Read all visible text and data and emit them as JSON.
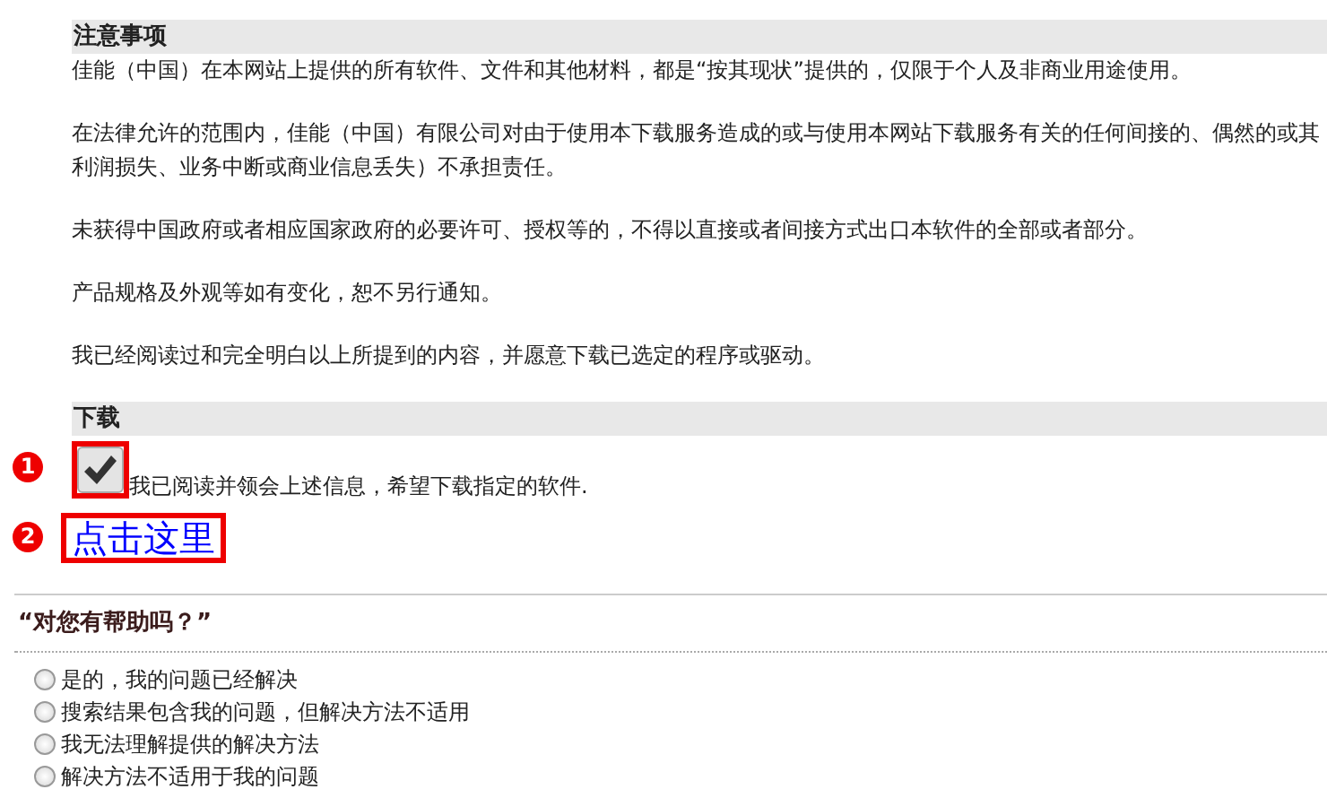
{
  "notice": {
    "heading": "注意事项",
    "paragraphs": [
      {
        "lines": [
          "佳能（中国）在本网站上提供的所有软件、文件和其他材料，都是“按其现状”提供的，仅限于个人及非商业用途使用。"
        ]
      },
      {
        "lines": [
          "在法律允许的范围内，佳能（中国）有限公司对由于使用本下载服务造成的或与使用本网站下载服务有关的任何间接的、偶然的或其",
          "利润损失、业务中断或商业信息丢失）不承担责任。"
        ]
      },
      {
        "lines": [
          "未获得中国政府或者相应国家政府的必要许可、授权等的，不得以直接或者间接方式出口本软件的全部或者部分。"
        ]
      },
      {
        "lines": [
          "产品规格及外观等如有变化，恕不另行通知。"
        ]
      },
      {
        "lines": [
          "我已经阅读过和完全明白以上所提到的内容，并愿意下载已选定的程序或驱动。"
        ]
      }
    ]
  },
  "download": {
    "heading": "下载",
    "agree": {
      "label": "我已阅读并领会上述信息，希望下载指定的软件.",
      "checked": true,
      "callout": "1"
    },
    "link": {
      "label": "点击这里",
      "callout": "2"
    }
  },
  "feedback": {
    "question": "“对您有帮助吗？”",
    "options": [
      {
        "label": "是的，我的问题已经解决",
        "selected": false
      },
      {
        "label": "搜索结果包含我的问题，但解决方法不适用",
        "selected": false
      },
      {
        "label": "我无法理解提供的解决方法",
        "selected": false
      },
      {
        "label": "解决方法不适用于我的问题",
        "selected": false
      }
    ]
  }
}
